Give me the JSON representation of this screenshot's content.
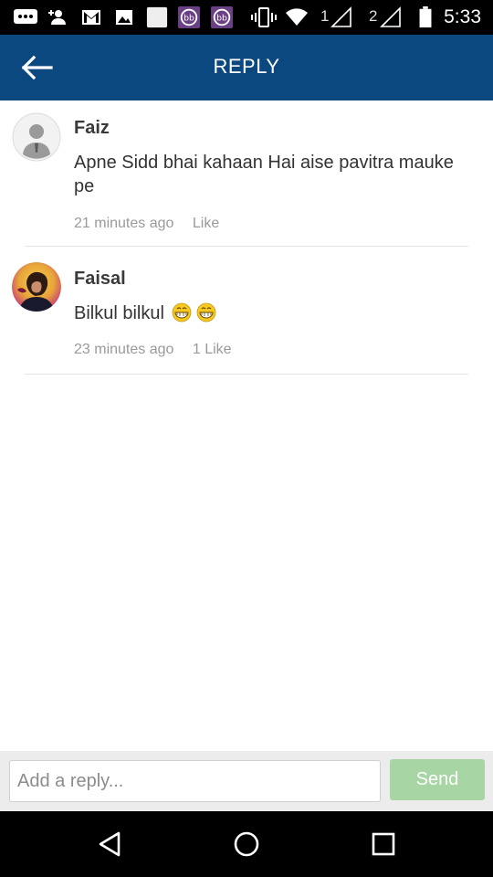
{
  "status_bar": {
    "sim1": "1",
    "sim2": "2",
    "time": "5:33"
  },
  "header": {
    "title": "REPLY",
    "back_icon": "arrow-left-icon"
  },
  "comments": [
    {
      "author": "Faiz",
      "text": "Apne Sidd bhai kahaan Hai aise pavitra mauke pe",
      "time": "21 minutes ago",
      "like": "Like",
      "avatar": "default-user-avatar"
    },
    {
      "author": "Faisal",
      "text": "Bilkul bilkul",
      "emoji": "grinning-emoji",
      "time": "23 minutes ago",
      "like": "1 Like",
      "avatar": "user-photo-avatar"
    }
  ],
  "reply_bar": {
    "placeholder": "Add a reply...",
    "send_label": "Send"
  },
  "colors": {
    "header_bg": "#0b4880",
    "send_bg": "#a7d5a3",
    "meta_text": "#9a9a9a"
  }
}
